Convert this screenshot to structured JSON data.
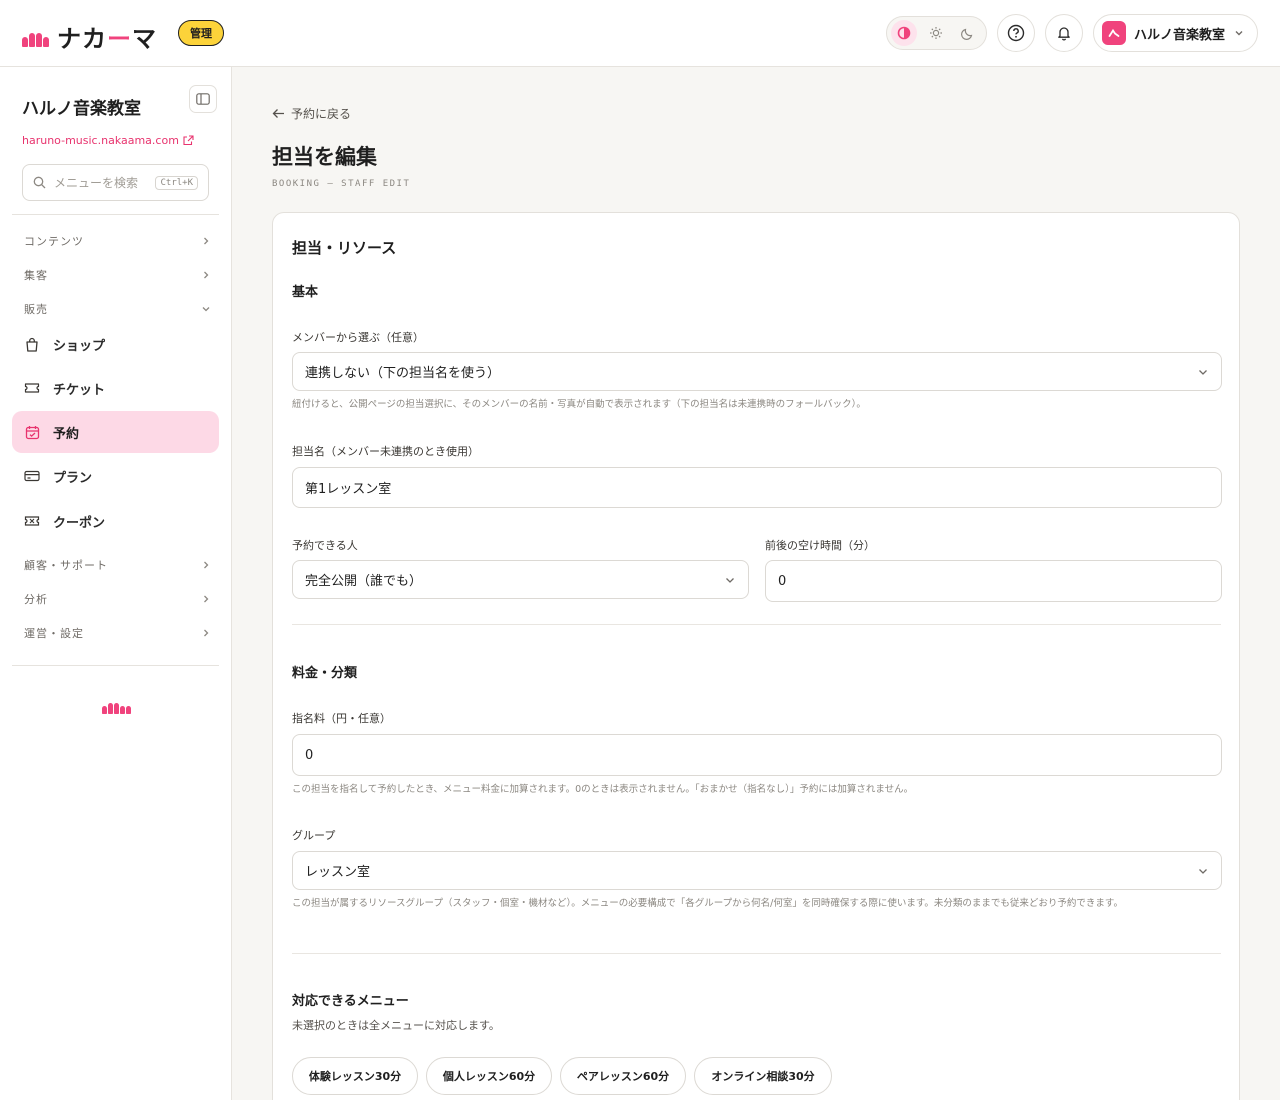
{
  "header": {
    "logo_text_a": "ナカ",
    "logo_text_b": "ー",
    "logo_text_c": "マ",
    "admin_badge": "管理",
    "account_name": "ハルノ音楽教室",
    "brand_color": "#f0437d",
    "badge_color": "#fcd33a"
  },
  "sidebar": {
    "site_title": "ハルノ音楽教室",
    "site_url": "haruno-music.nakaama.com",
    "search_placeholder": "メニューを検索",
    "search_shortcut": "Ctrl+K",
    "sections": {
      "content": "コンテンツ",
      "marketing": "集客",
      "sales": "販売",
      "customer": "顧客・サポート",
      "analytics": "分析",
      "operations": "運営・設定"
    },
    "items": {
      "shop": "ショップ",
      "ticket": "チケット",
      "booking": "予約",
      "plan": "プラン",
      "coupon": "クーポン"
    },
    "active_color": "#fdd9e6"
  },
  "main": {
    "back_link": "予約に戻る",
    "page_title": "担当を編集",
    "page_subtitle": "BOOKING — STAFF EDIT",
    "card_title": "担当・リソース",
    "basic": {
      "title": "基本",
      "member_label": "メンバーから選ぶ（任意）",
      "member_value": "連携しない（下の担当名を使う）",
      "member_help": "紐付けると、公開ページの担当選択に、そのメンバーの名前・写真が自動で表示されます（下の担当名は未連携時のフォールバック）。",
      "name_label": "担当名（メンバー未連携のとき使用）",
      "name_value": "第1レッスン室",
      "who_label": "予約できる人",
      "who_value": "完全公開（誰でも）",
      "buffer_label": "前後の空け時間（分）",
      "buffer_value": "0"
    },
    "pricing": {
      "title": "料金・分類",
      "fee_label": "指名料（円・任意）",
      "fee_value": "0",
      "fee_help": "この担当を指名して予約したとき、メニュー料金に加算されます。0のときは表示されません。「おまかせ（指名なし）」予約には加算されません。",
      "group_label": "グループ",
      "group_value": "レッスン室",
      "group_help": "この担当が属するリソースグループ（スタッフ・個室・機材など）。メニューの必要構成で「各グループから何名/何室」を同時確保する際に使います。未分類のままでも従来どおり予約できます。"
    },
    "menus": {
      "title": "対応できるメニュー",
      "help": "未選択のときは全メニューに対応します。",
      "chips": [
        "体験レッスン30分",
        "個人レッスン60分",
        "ペアレッスン60分",
        "オンライン相談30分"
      ]
    }
  }
}
